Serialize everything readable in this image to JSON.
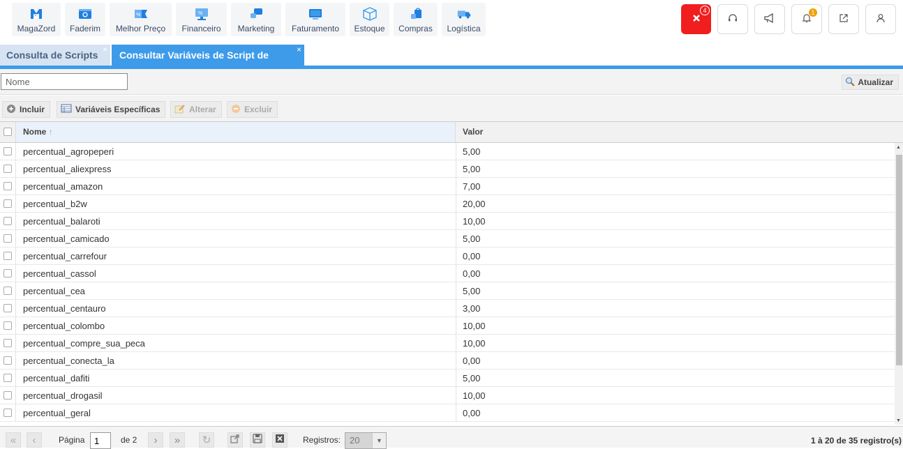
{
  "modules": [
    {
      "label": "MagaZord",
      "icon": "magazord-logo-icon"
    },
    {
      "label": "Faderim",
      "icon": "faderim-icon"
    },
    {
      "label": "Melhor Preço",
      "icon": "price-tag-icon"
    },
    {
      "label": "Financeiro",
      "icon": "finance-monitor-icon"
    },
    {
      "label": "Marketing",
      "icon": "marketing-chat-icon"
    },
    {
      "label": "Faturamento",
      "icon": "billing-monitor-icon"
    },
    {
      "label": "Estoque",
      "icon": "box-icon"
    },
    {
      "label": "Compras",
      "icon": "shopping-bag-icon"
    },
    {
      "label": "Logística",
      "icon": "truck-icon"
    }
  ],
  "header": {
    "close_badge": "4",
    "notification_badge": "1"
  },
  "tabs": [
    {
      "label": "Consulta de Scripts",
      "close": "×"
    },
    {
      "label": "Consultar Variáveis de Script de Preço",
      "close": "×"
    }
  ],
  "filter": {
    "placeholder": "Nome",
    "refresh_label": "Atualizar"
  },
  "toolbar": {
    "add_label": "Incluir",
    "specific_vars_label": "Variáveis Específicas",
    "edit_label": "Alterar",
    "delete_label": "Excluir"
  },
  "grid": {
    "col_name": "Nome",
    "col_value": "Valor",
    "sort_indicator": "↑",
    "rows": [
      {
        "name": "percentual_agropeperi",
        "value": "5,00"
      },
      {
        "name": "percentual_aliexpress",
        "value": "5,00"
      },
      {
        "name": "percentual_amazon",
        "value": "7,00"
      },
      {
        "name": "percentual_b2w",
        "value": "20,00"
      },
      {
        "name": "percentual_balaroti",
        "value": "10,00"
      },
      {
        "name": "percentual_camicado",
        "value": "5,00"
      },
      {
        "name": "percentual_carrefour",
        "value": "0,00"
      },
      {
        "name": "percentual_cassol",
        "value": "0,00"
      },
      {
        "name": "percentual_cea",
        "value": "5,00"
      },
      {
        "name": "percentual_centauro",
        "value": "3,00"
      },
      {
        "name": "percentual_colombo",
        "value": "10,00"
      },
      {
        "name": "percentual_compre_sua_peca",
        "value": "10,00"
      },
      {
        "name": "percentual_conecta_la",
        "value": "0,00"
      },
      {
        "name": "percentual_dafiti",
        "value": "5,00"
      },
      {
        "name": "percentual_drogasil",
        "value": "10,00"
      },
      {
        "name": "percentual_geral",
        "value": "0,00"
      }
    ]
  },
  "pager": {
    "page_label": "Página",
    "page_value": "1",
    "of_label": "de 2",
    "records_label": "Registros:",
    "records_value": "20",
    "info": "1 à 20 de 35 registro(s)"
  },
  "colors": {
    "accent": "#3d9be9",
    "danger": "#f01e1e",
    "brand_icon": "#1e7fe0"
  }
}
